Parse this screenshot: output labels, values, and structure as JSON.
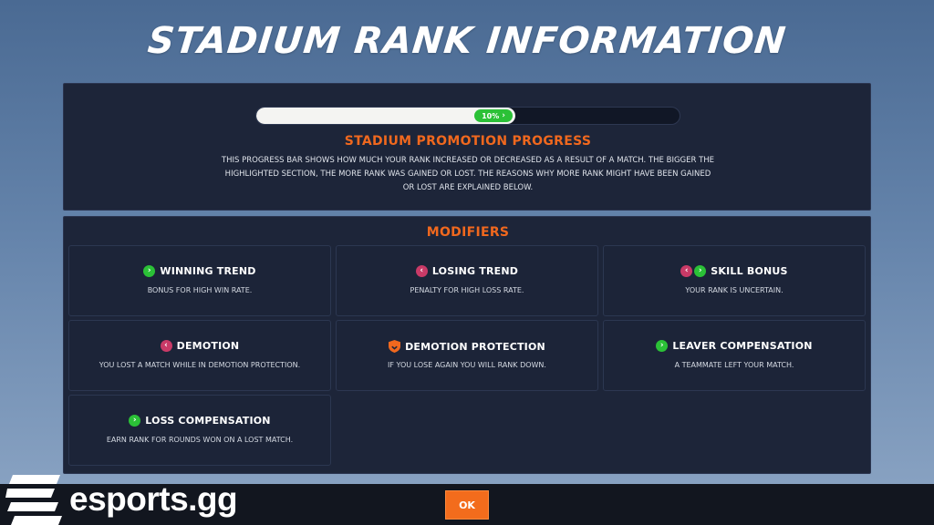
{
  "title": "STADIUM RANK INFORMATION",
  "progress": {
    "fraction": 0.61,
    "label": "10%",
    "colors": {
      "track": "#111726",
      "fill": "#f4f4f2",
      "pill": "#2bc137"
    }
  },
  "promotion": {
    "title": "STADIUM PROMOTION PROGRESS",
    "description": "THIS PROGRESS BAR SHOWS HOW MUCH YOUR RANK INCREASED OR DECREASED AS A RESULT OF A MATCH. THE BIGGER THE HIGHLIGHTED SECTION, THE MORE RANK WAS GAINED OR LOST. THE REASONS WHY MORE RANK MIGHT HAVE BEEN GAINED OR LOST ARE EXPLAINED BELOW."
  },
  "modifiers": {
    "title": "MODIFIERS",
    "items": [
      {
        "name": "WINNING TREND",
        "desc": "BONUS FOR HIGH WIN RATE.",
        "icons": [
          "chevron-up-green-icon"
        ]
      },
      {
        "name": "LOSING TREND",
        "desc": "PENALTY FOR HIGH LOSS RATE.",
        "icons": [
          "chevron-down-red-icon"
        ]
      },
      {
        "name": "SKILL BONUS",
        "desc": "YOUR RANK IS UNCERTAIN.",
        "icons": [
          "chevron-down-red-icon",
          "chevron-up-green-icon"
        ]
      },
      {
        "name": "DEMOTION",
        "desc": "YOU LOST A MATCH WHILE IN DEMOTION PROTECTION.",
        "icons": [
          "chevron-down-red-icon"
        ]
      },
      {
        "name": "DEMOTION PROTECTION",
        "desc": "IF YOU LOSE AGAIN YOU WILL RANK DOWN.",
        "icons": [
          "shield-orange-icon"
        ]
      },
      {
        "name": "LEAVER COMPENSATION",
        "desc": "A TEAMMATE LEFT YOUR MATCH.",
        "icons": [
          "chevron-up-green-icon"
        ]
      },
      {
        "name": "LOSS COMPENSATION",
        "desc": "EARN RANK FOR ROUNDS WON ON A LOST MATCH.",
        "icons": [
          "chevron-up-green-icon"
        ]
      }
    ]
  },
  "footer": {
    "ok_label": "OK",
    "watermark": "esports.gg"
  },
  "colors": {
    "accent": "#f0681e",
    "panel": "#1d2539",
    "up": "#2bc137",
    "down": "#c93a67",
    "ok_button": "#f36c1c"
  }
}
